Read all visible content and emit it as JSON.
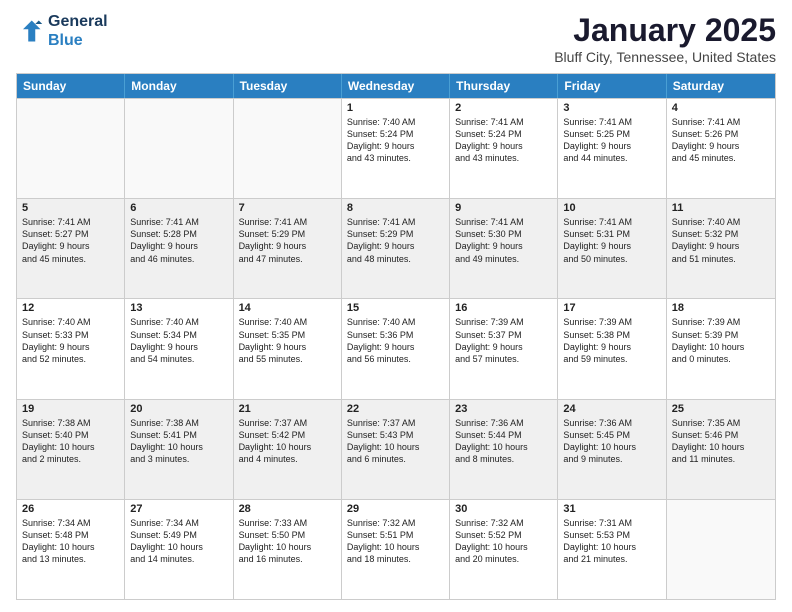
{
  "header": {
    "logo_line1": "General",
    "logo_line2": "Blue",
    "month": "January 2025",
    "location": "Bluff City, Tennessee, United States"
  },
  "weekdays": [
    "Sunday",
    "Monday",
    "Tuesday",
    "Wednesday",
    "Thursday",
    "Friday",
    "Saturday"
  ],
  "rows": [
    [
      {
        "day": "",
        "text": ""
      },
      {
        "day": "",
        "text": ""
      },
      {
        "day": "",
        "text": ""
      },
      {
        "day": "1",
        "text": "Sunrise: 7:40 AM\nSunset: 5:24 PM\nDaylight: 9 hours\nand 43 minutes."
      },
      {
        "day": "2",
        "text": "Sunrise: 7:41 AM\nSunset: 5:24 PM\nDaylight: 9 hours\nand 43 minutes."
      },
      {
        "day": "3",
        "text": "Sunrise: 7:41 AM\nSunset: 5:25 PM\nDaylight: 9 hours\nand 44 minutes."
      },
      {
        "day": "4",
        "text": "Sunrise: 7:41 AM\nSunset: 5:26 PM\nDaylight: 9 hours\nand 45 minutes."
      }
    ],
    [
      {
        "day": "5",
        "text": "Sunrise: 7:41 AM\nSunset: 5:27 PM\nDaylight: 9 hours\nand 45 minutes."
      },
      {
        "day": "6",
        "text": "Sunrise: 7:41 AM\nSunset: 5:28 PM\nDaylight: 9 hours\nand 46 minutes."
      },
      {
        "day": "7",
        "text": "Sunrise: 7:41 AM\nSunset: 5:29 PM\nDaylight: 9 hours\nand 47 minutes."
      },
      {
        "day": "8",
        "text": "Sunrise: 7:41 AM\nSunset: 5:29 PM\nDaylight: 9 hours\nand 48 minutes."
      },
      {
        "day": "9",
        "text": "Sunrise: 7:41 AM\nSunset: 5:30 PM\nDaylight: 9 hours\nand 49 minutes."
      },
      {
        "day": "10",
        "text": "Sunrise: 7:41 AM\nSunset: 5:31 PM\nDaylight: 9 hours\nand 50 minutes."
      },
      {
        "day": "11",
        "text": "Sunrise: 7:40 AM\nSunset: 5:32 PM\nDaylight: 9 hours\nand 51 minutes."
      }
    ],
    [
      {
        "day": "12",
        "text": "Sunrise: 7:40 AM\nSunset: 5:33 PM\nDaylight: 9 hours\nand 52 minutes."
      },
      {
        "day": "13",
        "text": "Sunrise: 7:40 AM\nSunset: 5:34 PM\nDaylight: 9 hours\nand 54 minutes."
      },
      {
        "day": "14",
        "text": "Sunrise: 7:40 AM\nSunset: 5:35 PM\nDaylight: 9 hours\nand 55 minutes."
      },
      {
        "day": "15",
        "text": "Sunrise: 7:40 AM\nSunset: 5:36 PM\nDaylight: 9 hours\nand 56 minutes."
      },
      {
        "day": "16",
        "text": "Sunrise: 7:39 AM\nSunset: 5:37 PM\nDaylight: 9 hours\nand 57 minutes."
      },
      {
        "day": "17",
        "text": "Sunrise: 7:39 AM\nSunset: 5:38 PM\nDaylight: 9 hours\nand 59 minutes."
      },
      {
        "day": "18",
        "text": "Sunrise: 7:39 AM\nSunset: 5:39 PM\nDaylight: 10 hours\nand 0 minutes."
      }
    ],
    [
      {
        "day": "19",
        "text": "Sunrise: 7:38 AM\nSunset: 5:40 PM\nDaylight: 10 hours\nand 2 minutes."
      },
      {
        "day": "20",
        "text": "Sunrise: 7:38 AM\nSunset: 5:41 PM\nDaylight: 10 hours\nand 3 minutes."
      },
      {
        "day": "21",
        "text": "Sunrise: 7:37 AM\nSunset: 5:42 PM\nDaylight: 10 hours\nand 4 minutes."
      },
      {
        "day": "22",
        "text": "Sunrise: 7:37 AM\nSunset: 5:43 PM\nDaylight: 10 hours\nand 6 minutes."
      },
      {
        "day": "23",
        "text": "Sunrise: 7:36 AM\nSunset: 5:44 PM\nDaylight: 10 hours\nand 8 minutes."
      },
      {
        "day": "24",
        "text": "Sunrise: 7:36 AM\nSunset: 5:45 PM\nDaylight: 10 hours\nand 9 minutes."
      },
      {
        "day": "25",
        "text": "Sunrise: 7:35 AM\nSunset: 5:46 PM\nDaylight: 10 hours\nand 11 minutes."
      }
    ],
    [
      {
        "day": "26",
        "text": "Sunrise: 7:34 AM\nSunset: 5:48 PM\nDaylight: 10 hours\nand 13 minutes."
      },
      {
        "day": "27",
        "text": "Sunrise: 7:34 AM\nSunset: 5:49 PM\nDaylight: 10 hours\nand 14 minutes."
      },
      {
        "day": "28",
        "text": "Sunrise: 7:33 AM\nSunset: 5:50 PM\nDaylight: 10 hours\nand 16 minutes."
      },
      {
        "day": "29",
        "text": "Sunrise: 7:32 AM\nSunset: 5:51 PM\nDaylight: 10 hours\nand 18 minutes."
      },
      {
        "day": "30",
        "text": "Sunrise: 7:32 AM\nSunset: 5:52 PM\nDaylight: 10 hours\nand 20 minutes."
      },
      {
        "day": "31",
        "text": "Sunrise: 7:31 AM\nSunset: 5:53 PM\nDaylight: 10 hours\nand 21 minutes."
      },
      {
        "day": "",
        "text": ""
      }
    ]
  ]
}
